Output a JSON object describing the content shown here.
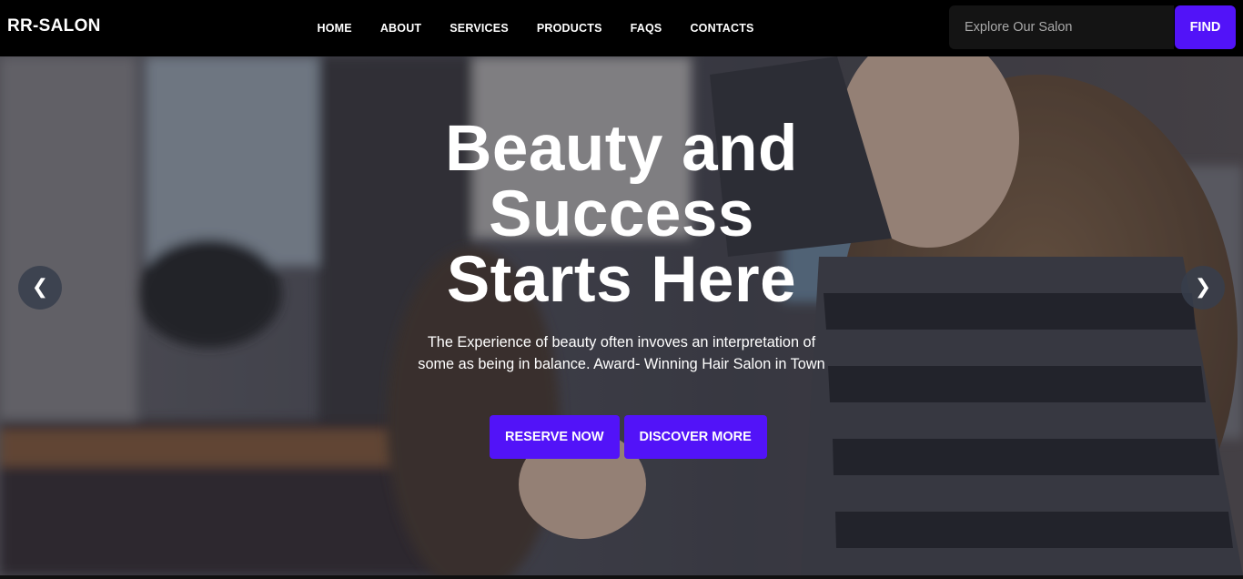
{
  "navbar": {
    "brand": "RR-SALON",
    "links": [
      "HOME",
      "ABOUT",
      "SERVICES",
      "PRODUCTS",
      "FAQS",
      "CONTACTS"
    ],
    "search": {
      "placeholder": "Explore Our Salon",
      "button_label": "FIND"
    }
  },
  "hero": {
    "title_line1": "Beauty and",
    "title_line2": "Success",
    "title_line3": "Starts Here",
    "subtitle": "The Experience of beauty often invoves an interpretation of some as being in balance. Award- Winning Hair Salon in Town",
    "buttons": {
      "primary": "RESERVE NOW",
      "secondary": "DISCOVER MORE"
    },
    "prev_icon": "❮",
    "next_icon": "❯"
  },
  "colors": {
    "accent": "#5213f8",
    "navbar_bg": "#000000",
    "text": "#ffffff"
  }
}
